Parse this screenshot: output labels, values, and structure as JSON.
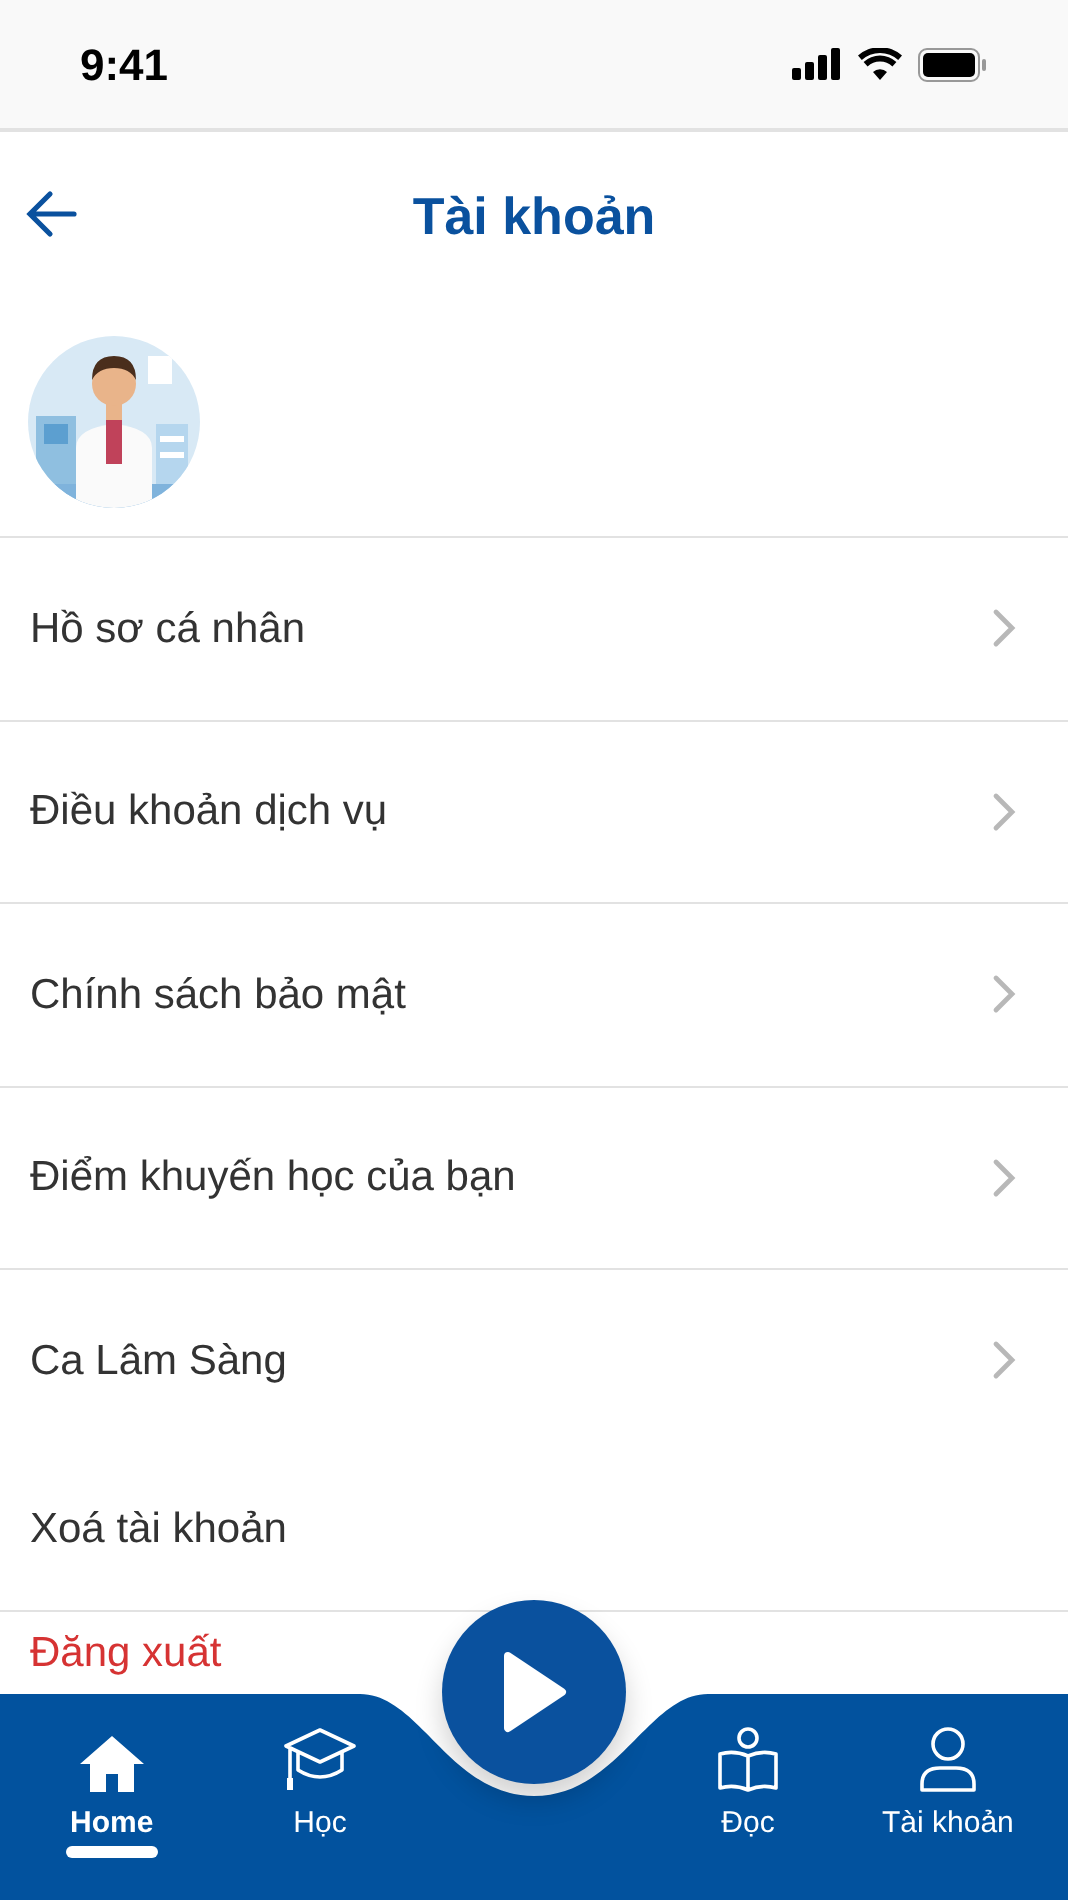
{
  "status_bar": {
    "time": "9:41"
  },
  "header": {
    "title": "Tài khoản"
  },
  "menu": [
    {
      "label": "Hồ sơ cá nhân",
      "kind": "link",
      "chevron": true
    },
    {
      "label": "Điều khoản dịch vụ",
      "kind": "link",
      "chevron": true
    },
    {
      "label": "Chính sách bảo mật",
      "kind": "link",
      "chevron": true
    },
    {
      "label": "Điểm khuyến học của bạn",
      "kind": "link",
      "chevron": true
    },
    {
      "label": "Ca Lâm Sàng",
      "kind": "link",
      "chevron": true
    },
    {
      "label": "Xoá tài khoản",
      "kind": "link",
      "chevron": false
    },
    {
      "label": "Đăng xuất",
      "kind": "danger"
    }
  ],
  "tab_bar": [
    {
      "label": "Home",
      "selected": true
    },
    {
      "label": "Học",
      "selected": false
    },
    {
      "label": "Đọc",
      "selected": false
    },
    {
      "label": "Tài khoản",
      "selected": false
    }
  ]
}
